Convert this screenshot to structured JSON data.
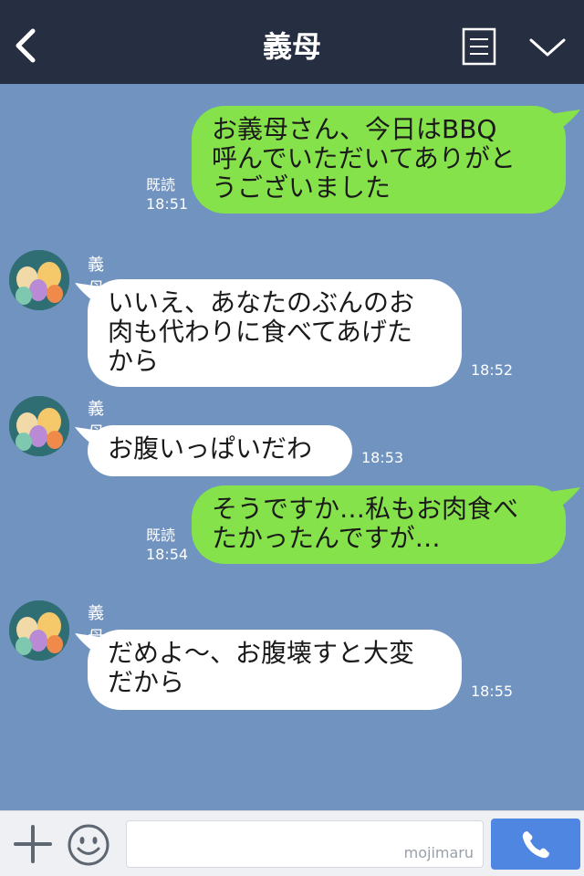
{
  "header": {
    "title": "義母",
    "back_icon": "chevron-left-icon",
    "menu_icon": "notes-icon",
    "more_icon": "chevron-down-icon"
  },
  "messages": [
    {
      "side": "me",
      "lines": [
        "お義母さん、今日はBBQ",
        "呼んでいただいてありがと",
        "うございました"
      ],
      "read": "既読",
      "time": "18:51"
    },
    {
      "side": "them",
      "sender": "義母",
      "lines": [
        "いいえ、あなたのぶんのお",
        "肉も代わりに食べてあげた",
        "から"
      ],
      "time": "18:52"
    },
    {
      "side": "them",
      "sender": "義母",
      "lines": [
        "お腹いっぱいだわ"
      ],
      "time": "18:53"
    },
    {
      "side": "me",
      "lines": [
        "そうですか…私もお肉食べ",
        "たかったんですが…"
      ],
      "read": "既読",
      "time": "18:54"
    },
    {
      "side": "them",
      "sender": "義母",
      "lines": [
        "だめよ〜、お腹壊すと大変",
        "だから"
      ],
      "time": "18:55"
    }
  ],
  "input_bar": {
    "add_icon": "plus-icon",
    "sticker_icon": "smile-icon",
    "placeholder": "",
    "watermark": "mojimaru",
    "call_icon": "phone-icon"
  },
  "colors": {
    "header_bg": "#262f42",
    "chat_bg": "#7193c0",
    "my_bubble": "#86e24a",
    "their_bubble": "#ffffff",
    "call_button": "#4f86e2"
  }
}
